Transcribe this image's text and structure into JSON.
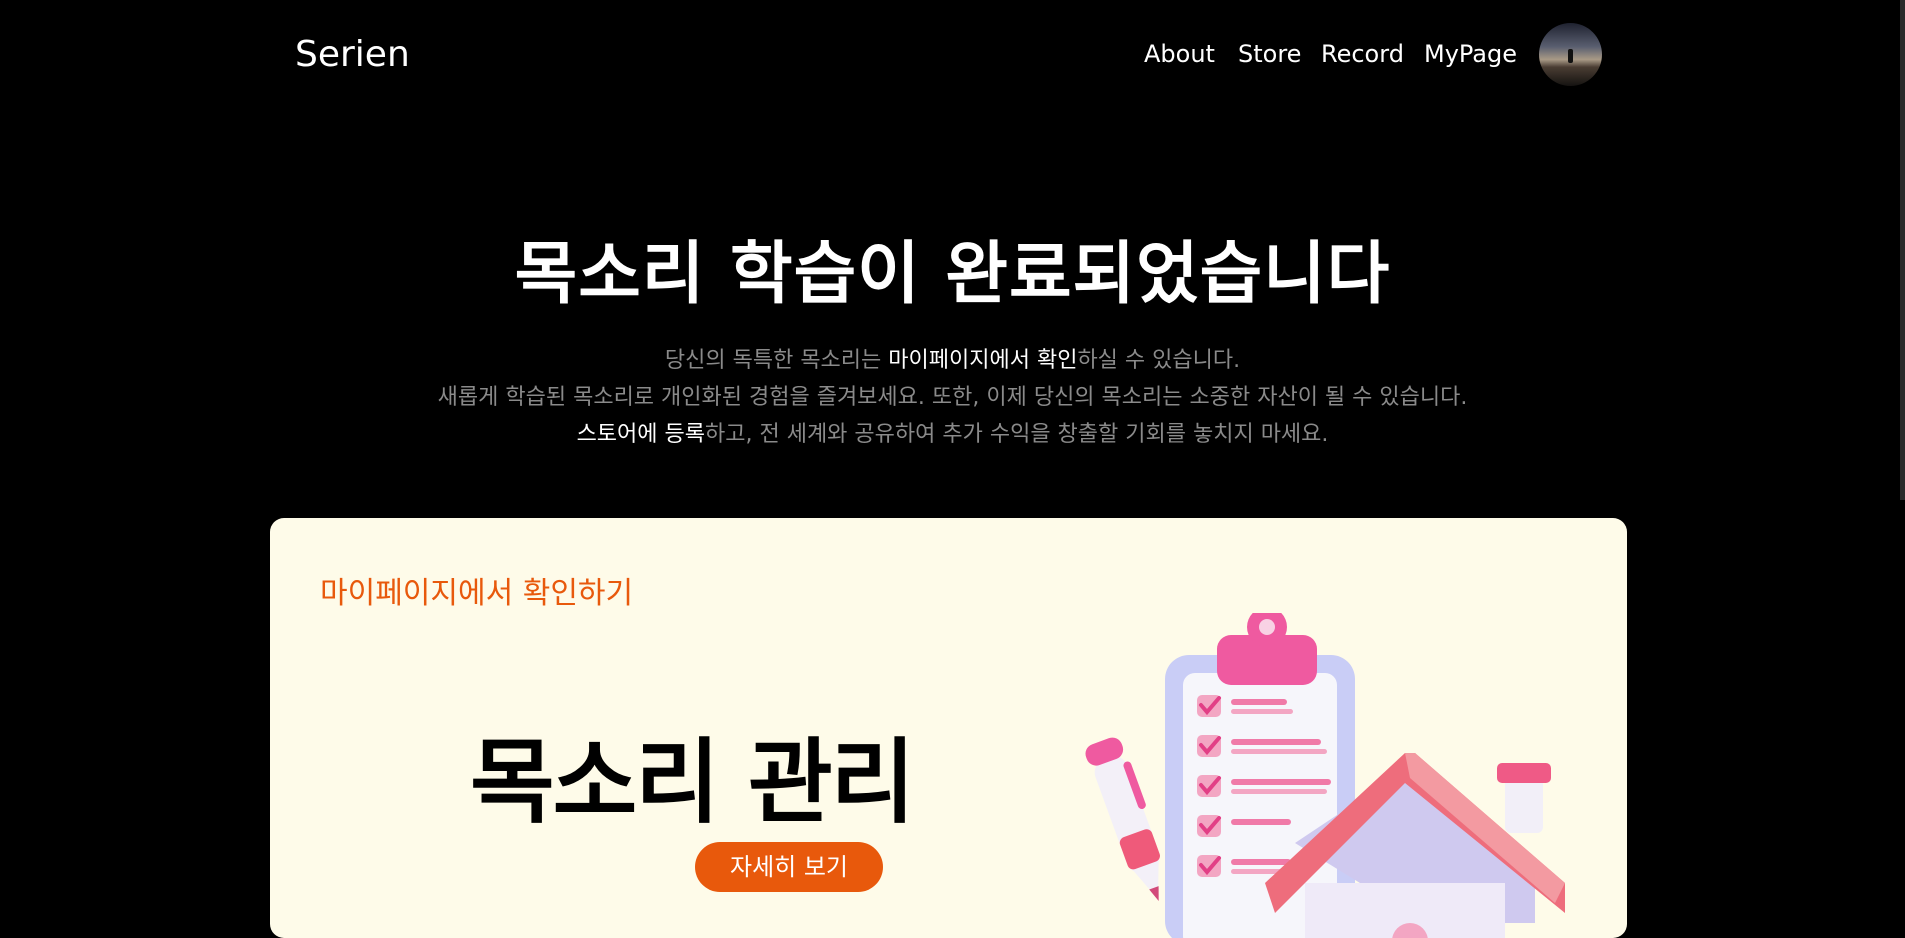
{
  "nav": {
    "logo": "Serien",
    "items": [
      "About",
      "Store",
      "Record",
      "MyPage"
    ]
  },
  "hero": {
    "title": "목소리 학습이 완료되었습니다",
    "line1": {
      "pre": "당신의 독특한 목소리는 ",
      "highlight": "마이페이지에서 확인",
      "post": "하실 수 있습니다."
    },
    "line2": "새롭게 학습된 목소리로 개인화된 경험을 즐겨보세요. 또한, 이제 당신의 목소리는 소중한 자산이 될 수 있습니다.",
    "line3": {
      "highlight": "스토어에 등록",
      "post": "하고, 전 세계와 공유하여 추가 수익을 창출할 기회를 놓치지 마세요."
    }
  },
  "card": {
    "label": "마이페이지에서 확인하기",
    "title": "목소리 관리",
    "button": "자세히 보기"
  },
  "colors": {
    "background": "#000000",
    "accent": "#e8590c",
    "card_bg": "#fefbe9",
    "muted_text": "#8a8a8a"
  },
  "icons": [
    "user-avatar",
    "clipboard-checklist-illustration",
    "pen-illustration",
    "house-illustration"
  ]
}
